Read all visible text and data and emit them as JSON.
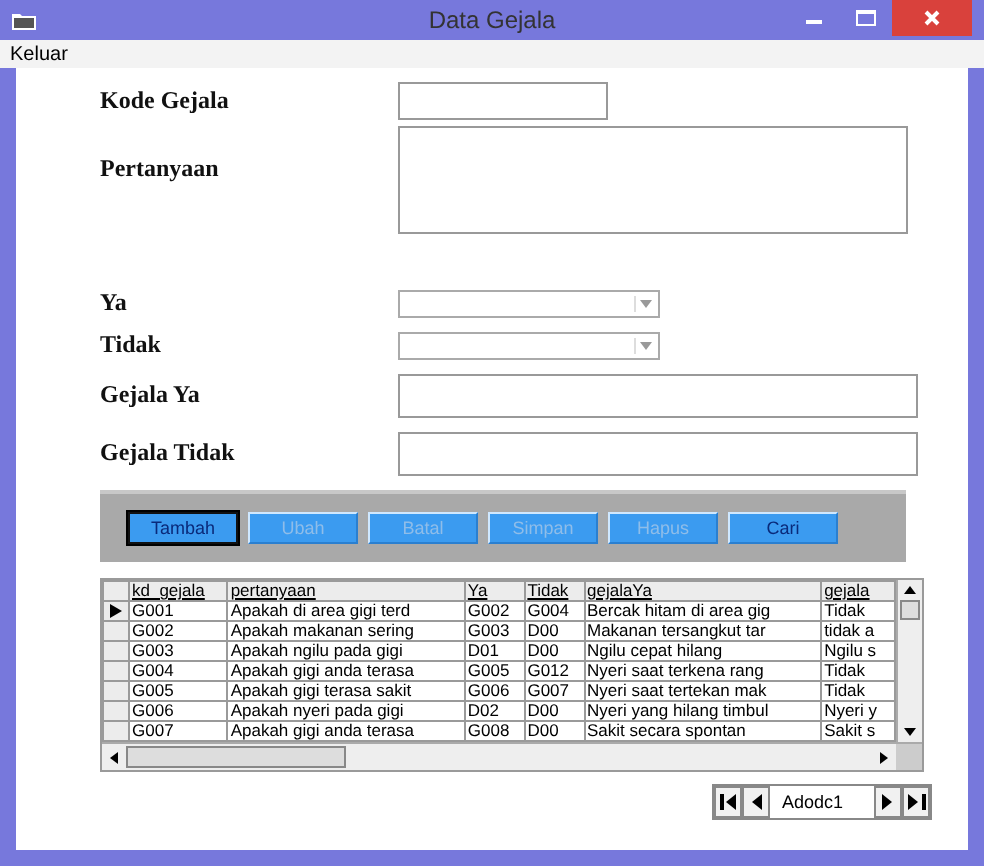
{
  "window": {
    "title": "Data Gejala"
  },
  "menu": [
    "Keluar"
  ],
  "form": [
    {
      "label": "Kode Gejala",
      "kind": "text"
    },
    {
      "label": "Pertanyaan",
      "kind": "textarea"
    },
    {
      "label": "Ya",
      "kind": "combo"
    },
    {
      "label": "Tidak",
      "kind": "combo"
    },
    {
      "label": "Gejala Ya",
      "kind": "wide"
    },
    {
      "label": "Gejala Tidak",
      "kind": "wide"
    }
  ],
  "buttons": [
    {
      "label": "Tambah",
      "disabled": false,
      "focused": true
    },
    {
      "label": "Ubah",
      "disabled": true,
      "focused": false
    },
    {
      "label": "Batal",
      "disabled": true,
      "focused": false
    },
    {
      "label": "Simpan",
      "disabled": true,
      "focused": false
    },
    {
      "label": "Hapus",
      "disabled": true,
      "focused": false
    },
    {
      "label": "Cari",
      "disabled": false,
      "focused": false
    }
  ],
  "table": {
    "columns": [
      "kd_gejala",
      "pertanyaan",
      "Ya",
      "Tidak",
      "gejalaYa",
      "gejala"
    ],
    "rows": [
      {
        "selected": true,
        "cells": [
          "G001",
          "Apakah di area gigi terd",
          "G002",
          "G004",
          "Bercak hitam di area gig",
          "Tidak"
        ]
      },
      {
        "selected": false,
        "cells": [
          "G002",
          "Apakah makanan sering",
          "G003",
          "D00",
          "Makanan tersangkut tar",
          "tidak a"
        ]
      },
      {
        "selected": false,
        "cells": [
          "G003",
          "Apakah ngilu pada gigi",
          "D01",
          "D00",
          "Ngilu cepat hilang",
          "Ngilu s"
        ]
      },
      {
        "selected": false,
        "cells": [
          "G004",
          "Apakah gigi anda terasa",
          "G005",
          "G012",
          "Nyeri saat terkena rang",
          "Tidak"
        ]
      },
      {
        "selected": false,
        "cells": [
          "G005",
          "Apakah gigi terasa sakit",
          "G006",
          "G007",
          "Nyeri saat tertekan mak",
          "Tidak"
        ]
      },
      {
        "selected": false,
        "cells": [
          "G006",
          "Apakah nyeri pada gigi",
          "D02",
          "D00",
          "Nyeri yang hilang timbul",
          "Nyeri y"
        ]
      },
      {
        "selected": false,
        "cells": [
          "G007",
          "Apakah gigi anda terasa",
          "G008",
          "D00",
          "Sakit secara spontan",
          "Sakit s"
        ]
      }
    ]
  },
  "navigator": {
    "caption": "Adodc1"
  }
}
